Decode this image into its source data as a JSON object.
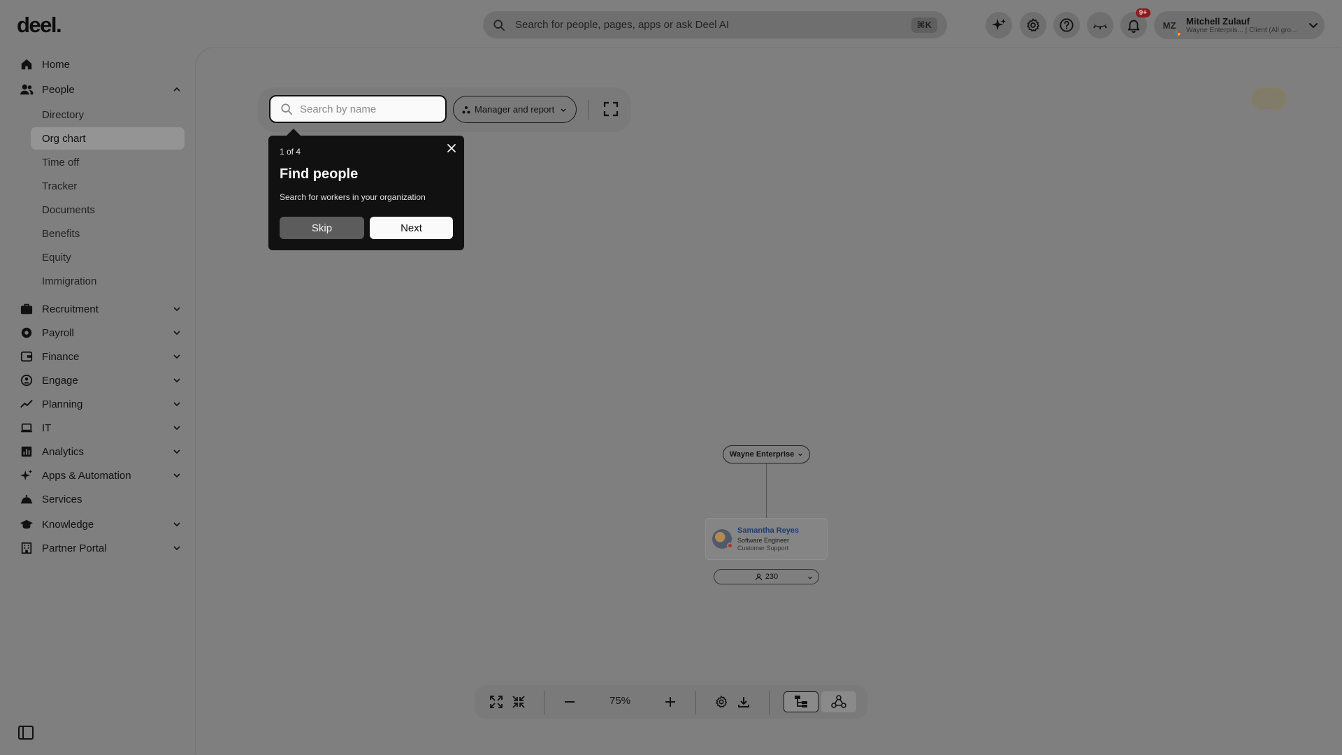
{
  "app": {
    "logo": "deel."
  },
  "search": {
    "placeholder": "Search for people, pages, apps or ask Deel AI",
    "shortcut": "⌘K"
  },
  "topbar": {
    "icons": [
      "sparkle-icon",
      "gear-icon",
      "help-icon",
      "eye-closed-icon",
      "bell-icon"
    ],
    "notification_badge": "9+"
  },
  "user": {
    "initials": "MZ",
    "name": "Mitchell Zulauf",
    "subtitle": "Wayne Enterpris... | Client (All gro..."
  },
  "sidebar": {
    "items": [
      {
        "label": "Home",
        "icon": "home-icon"
      },
      {
        "label": "People",
        "icon": "people-icon",
        "expanded": true
      },
      {
        "label": "Recruitment",
        "icon": "briefcase-icon"
      },
      {
        "label": "Payroll",
        "icon": "payroll-icon"
      },
      {
        "label": "Finance",
        "icon": "wallet-icon"
      },
      {
        "label": "Engage",
        "icon": "engage-icon"
      },
      {
        "label": "Planning",
        "icon": "trend-icon"
      },
      {
        "label": "IT",
        "icon": "laptop-icon"
      },
      {
        "label": "Analytics",
        "icon": "chart-icon"
      },
      {
        "label": "Apps & Automation",
        "icon": "sparkle-small-icon"
      },
      {
        "label": "Services",
        "icon": "bell-service-icon"
      },
      {
        "label": "Knowledge",
        "icon": "graduation-icon"
      },
      {
        "label": "Partner Portal",
        "icon": "building-icon"
      }
    ],
    "people_sub": [
      "Directory",
      "Org chart",
      "Time off",
      "Tracker",
      "Documents",
      "Benefits",
      "Equity",
      "Immigration"
    ],
    "active_sub": "Org chart"
  },
  "orgchart": {
    "search_placeholder": "Search by name",
    "view_mode": "Manager and report",
    "root": "Wayne Enterprise",
    "person": {
      "name": "Samantha Reyes",
      "title": "Software Engineer",
      "department": "Customer Support"
    },
    "reports_count": "230"
  },
  "tour": {
    "step": "1 of 4",
    "title": "Find people",
    "description": "Search for workers in your organization",
    "skip": "Skip",
    "next": "Next"
  },
  "controls": {
    "zoom": "75%"
  }
}
